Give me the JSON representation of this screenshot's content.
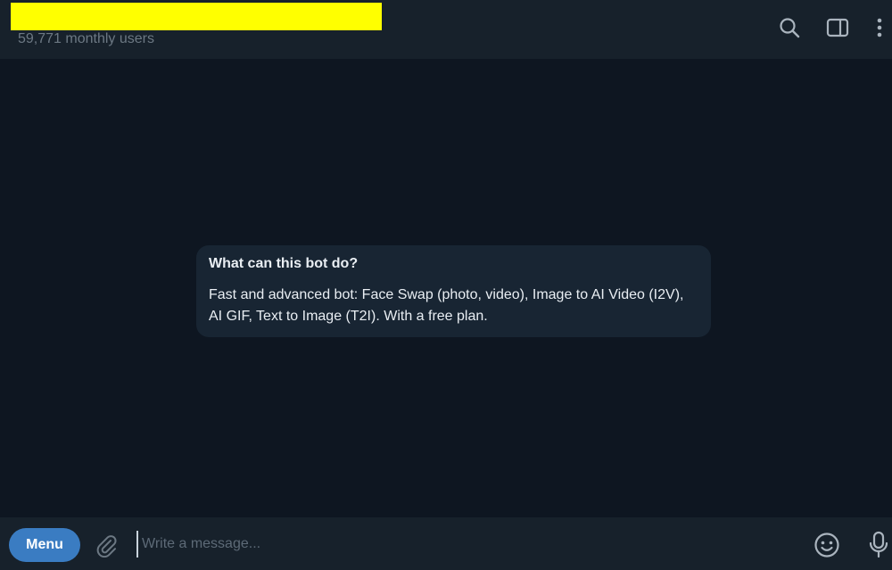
{
  "header": {
    "subtitle": "59,771 monthly users",
    "icons": [
      "search-icon",
      "sidebar-toggle-icon",
      "more-vertical-icon"
    ]
  },
  "bot_info": {
    "title": "What can this bot do?",
    "description": "Fast and advanced bot: Face Swap (photo, video), Image to AI Video (I2V), AI GIF, Text to Image (T2I). With a free plan."
  },
  "composer": {
    "menu_label": "Menu",
    "placeholder": "Write a message...",
    "value": "",
    "icons": [
      "attach-icon",
      "emoji-icon",
      "microphone-icon"
    ]
  },
  "colors": {
    "header_bg": "#17212b",
    "chat_bg": "#0e1621",
    "card_bg": "#182533",
    "accent": "#3a7cc2",
    "redaction": "#ffff00",
    "muted_text": "#6c7883"
  }
}
